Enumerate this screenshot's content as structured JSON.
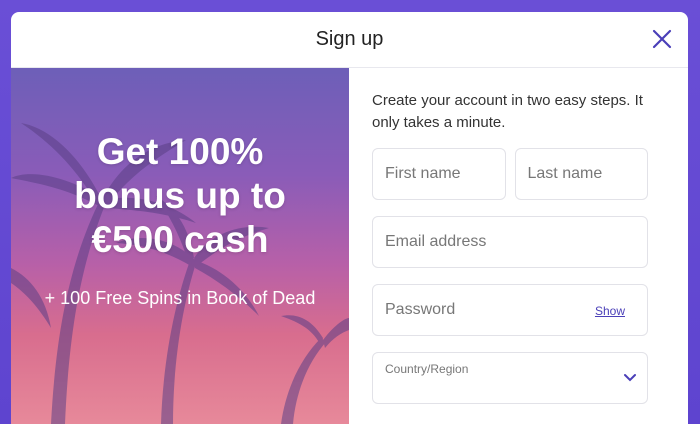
{
  "modal": {
    "title": "Sign up",
    "close_icon": "close-icon"
  },
  "promo": {
    "heading_line1": "Get 100%",
    "heading_line2": "bonus up to",
    "heading_line3": "€500 cash",
    "subtext": "+ 100 Free Spins in Book of Dead"
  },
  "form": {
    "intro": "Create your account in two easy steps. It only takes a minute.",
    "first_name_placeholder": "First name",
    "last_name_placeholder": "Last name",
    "email_placeholder": "Email address",
    "password_placeholder": "Password",
    "show_label": "Show",
    "country_label": "Country/Region",
    "country_icon": "chevron-down-icon"
  },
  "colors": {
    "background": "#6a4fd6",
    "accent": "#4a3fb8"
  }
}
